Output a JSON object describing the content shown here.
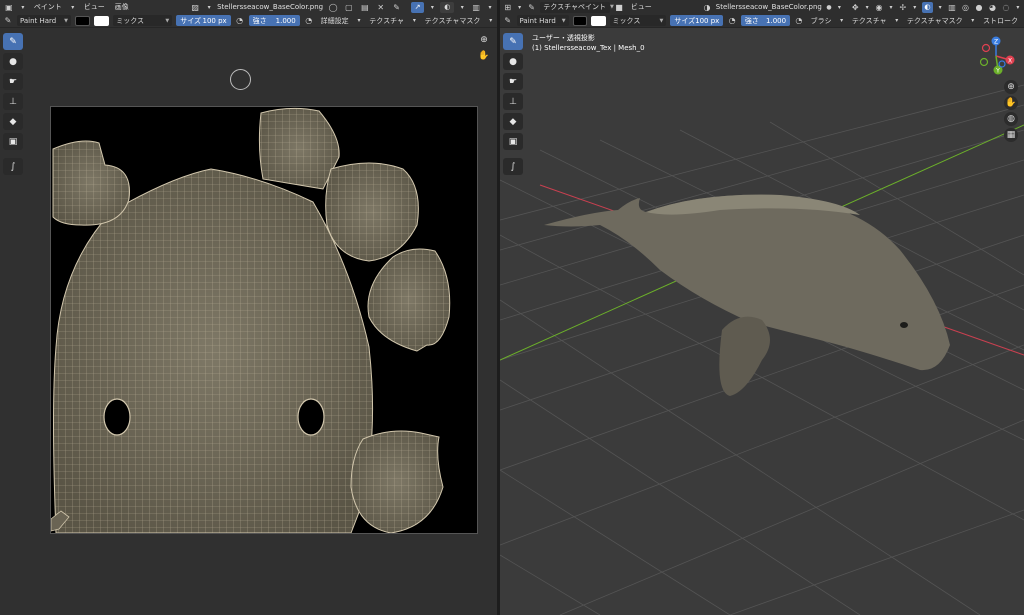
{
  "image_editor": {
    "menus": [
      "ペイント",
      "ビュー",
      "画像"
    ],
    "image_name": "Stellersseacow_BaseColor.png",
    "brush": "Paint Hard",
    "blend": "ミックス",
    "size_label": "サイズ",
    "size_value": "100 px",
    "strength_label": "強さ",
    "strength_value": "1.000",
    "advanced": "詳細設定",
    "texture": "テクスチャ",
    "texture_mask": "テクスチャマスク"
  },
  "viewport": {
    "mode": "テクスチャペイント",
    "menus": [
      "ビュー"
    ],
    "image_name": "Stellersseacow_BaseColor.png",
    "brush": "Paint Hard",
    "blend": "ミックス",
    "size_label": "サイズ",
    "size_value": "100 px",
    "strength_label": "強さ",
    "strength_value": "1.000",
    "brush_menu": "ブラシ",
    "texture": "テクスチャ",
    "texture_mask": "テクスチャマスク",
    "stroke": "ストローク",
    "view_label": "ユーザー・透視投影",
    "object_label": "(1) Stellersseacow_Tex | Mesh_0",
    "gizmo_axes": [
      "X",
      "Y",
      "Z"
    ]
  },
  "colors": {
    "accent": "#4772b3",
    "axis_x": "#e04050",
    "axis_y": "#6cb02a",
    "axis_z": "#3a7de0",
    "wire": "#8a7d64"
  },
  "icons": {
    "tools": [
      "brush-icon",
      "drop-icon",
      "smear-icon",
      "stamp-icon",
      "fill-icon",
      "mask-icon",
      "annotate-icon"
    ]
  }
}
